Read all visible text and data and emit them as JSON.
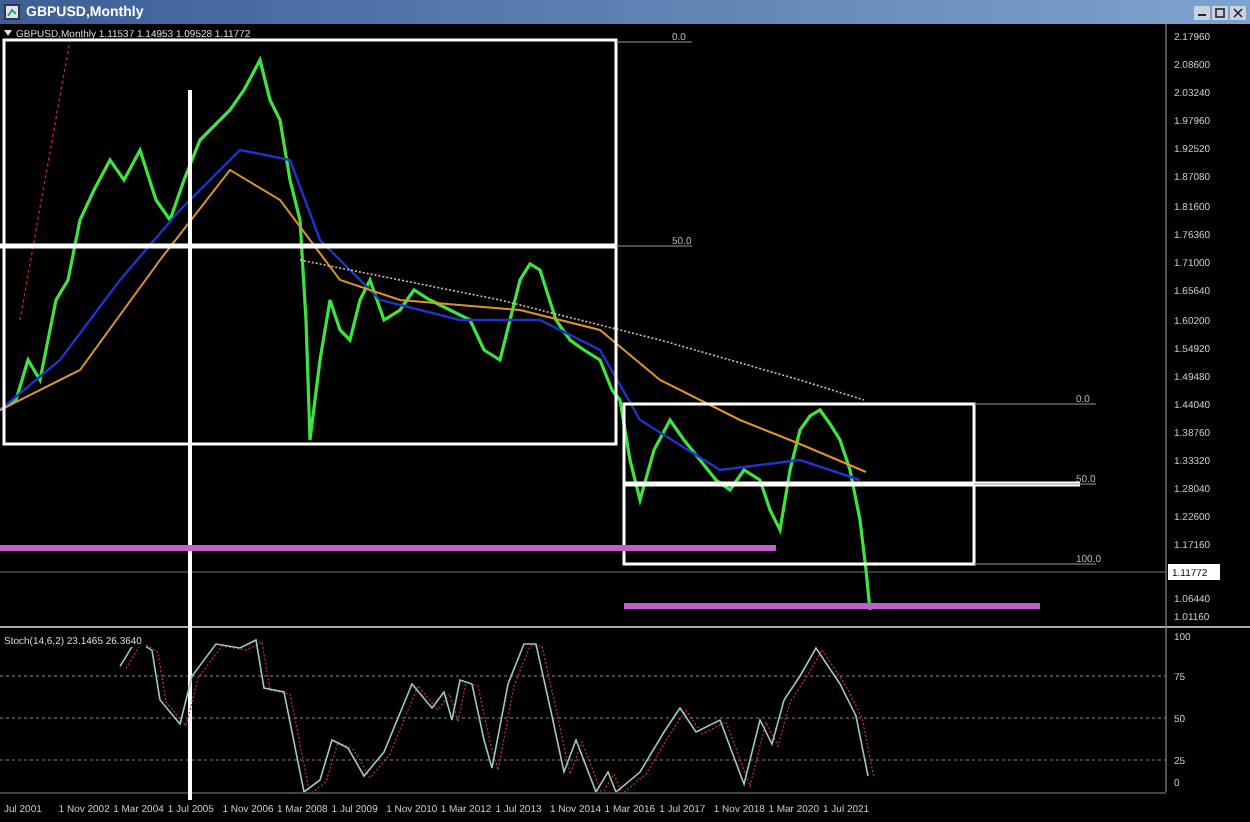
{
  "window": {
    "title": "GBPUSD,Monthly"
  },
  "chart_header": {
    "symbol_info": "GBPUSD,Monthly  1.11537 1.14953 1.09528 1.11772"
  },
  "price_axis": {
    "labels": [
      "2.17960",
      "2.08600",
      "2.03240",
      "1.97960",
      "1.92520",
      "1.87080",
      "1.81600",
      "1.76360",
      "1.71000",
      "1.65640",
      "1.60200",
      "1.54920",
      "1.49480",
      "1.44040",
      "1.38760",
      "1.33320",
      "1.28040",
      "1.22600",
      "1.17160",
      "1.06440",
      "1.01160"
    ],
    "current_price": "1.11772"
  },
  "fibonacci": [
    {
      "levels": [
        "0.0",
        "50.0"
      ]
    },
    {
      "levels": [
        "0.0",
        "50.0",
        "100.0"
      ]
    }
  ],
  "indicator": {
    "label": "Stoch(14,6,2) 23.1465 26.3640",
    "axis_labels": [
      "100",
      "75",
      "50",
      "25",
      "0"
    ]
  },
  "time_axis": {
    "labels": [
      "Jul 2001",
      "1 Nov 2002",
      "1 Mar 2004",
      "1 Jul 2005",
      "1 Nov 2006",
      "1 Mar 2008",
      "1 Jul 2009",
      "1 Nov 2010",
      "1 Mar 2012",
      "1 Jul 2013",
      "1 Nov 2014",
      "1 Mar 2016",
      "1 Jul 2017",
      "1 Nov 2018",
      "1 Mar 2020",
      "1 Jul 2021"
    ]
  }
}
